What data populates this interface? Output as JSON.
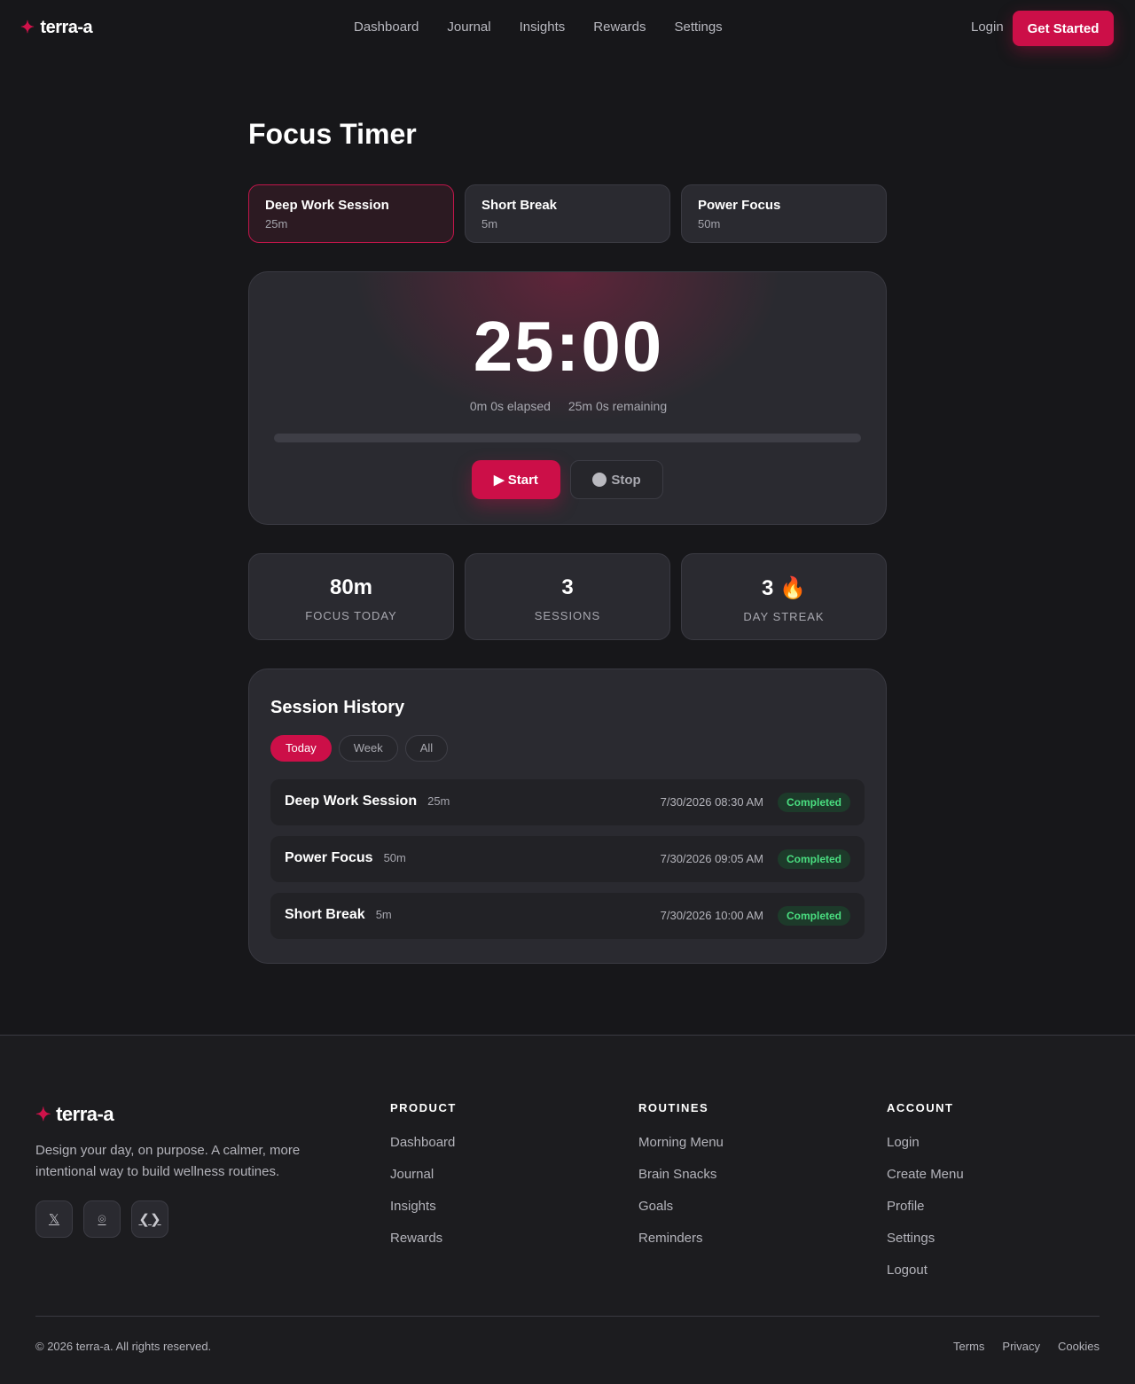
{
  "nav": {
    "brand": "terra-a",
    "links": [
      "Dashboard",
      "Journal",
      "Insights",
      "Rewards",
      "Settings"
    ],
    "login": "Login",
    "cta": "Get Started"
  },
  "page_title": "Focus Timer",
  "presets": [
    {
      "name": "Deep Work Session",
      "duration": "25m",
      "active": true
    },
    {
      "name": "Short Break",
      "duration": "5m",
      "active": false
    },
    {
      "name": "Power Focus",
      "duration": "50m",
      "active": false
    }
  ],
  "timer": {
    "display": "25:00",
    "elapsed": "0m 0s elapsed",
    "remaining": "25m 0s remaining",
    "progress_fraction": 0,
    "start_label": "▶ Start",
    "stop_label": "Stop"
  },
  "stats": [
    {
      "value": "80m",
      "label": "FOCUS TODAY"
    },
    {
      "value": "3",
      "label": "SESSIONS"
    },
    {
      "value": "3 🔥",
      "label": "DAY STREAK"
    }
  ],
  "history": {
    "title": "Session History",
    "filters": [
      "Today",
      "Week",
      "All"
    ],
    "active_filter": "Today",
    "rows": [
      {
        "name": "Deep Work Session",
        "duration": "25m",
        "date": "7/30/2026 08:30 AM",
        "status": "Completed"
      },
      {
        "name": "Power Focus",
        "duration": "50m",
        "date": "7/30/2026 09:05 AM",
        "status": "Completed"
      },
      {
        "name": "Short Break",
        "duration": "5m",
        "date": "7/30/2026 10:00 AM",
        "status": "Completed"
      }
    ]
  },
  "footer": {
    "brand": "terra-a",
    "tagline": "Design your day, on purpose. A calmer, more intentional way to build wellness routines.",
    "socials": [
      {
        "icon": "x-icon",
        "glyph": "𝕏"
      },
      {
        "icon": "instagram-icon",
        "glyph": "⌾"
      },
      {
        "icon": "code-icon",
        "glyph": "❮❯"
      }
    ],
    "columns": [
      {
        "title": "PRODUCT",
        "links": [
          "Dashboard",
          "Journal",
          "Insights",
          "Rewards"
        ]
      },
      {
        "title": "ROUTINES",
        "links": [
          "Morning Menu",
          "Brain Snacks",
          "Goals",
          "Reminders"
        ]
      },
      {
        "title": "ACCOUNT",
        "links": [
          "Login",
          "Create Menu",
          "Profile",
          "Settings",
          "Logout"
        ]
      }
    ],
    "copyright": "© 2026 terra-a. All rights reserved.",
    "legal": [
      "Terms",
      "Privacy",
      "Cookies"
    ]
  },
  "colors": {
    "accent": "#cc0f48",
    "background": "#17171a",
    "card": "#2a2a30",
    "success": "#4ade80"
  }
}
